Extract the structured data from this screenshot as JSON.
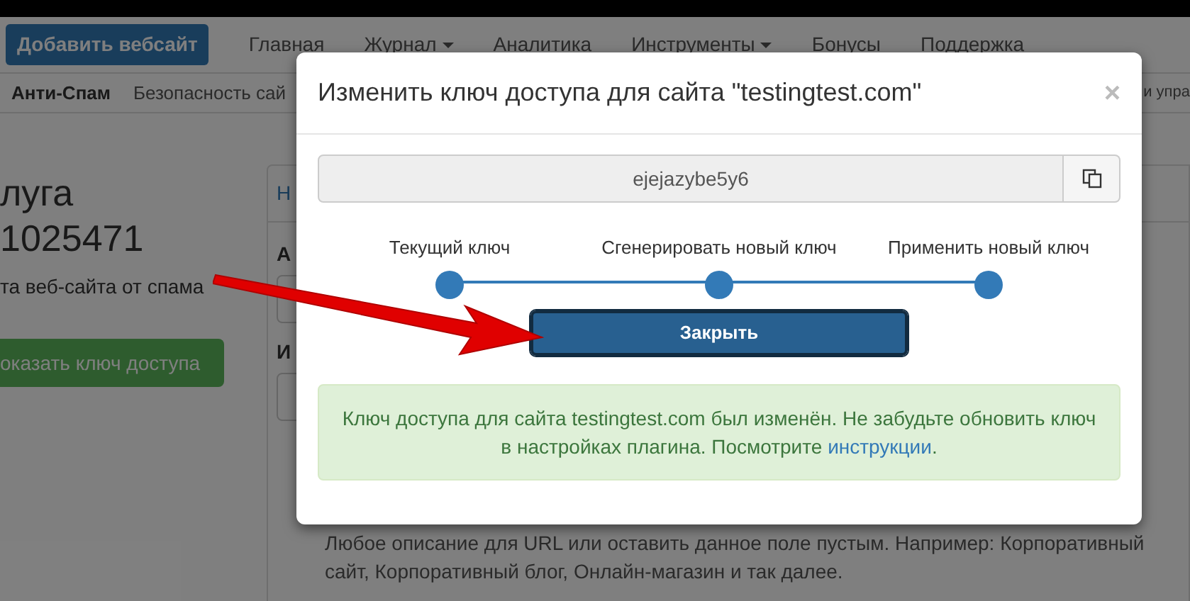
{
  "navbar": {
    "add_button": "Добавить вебсайт",
    "items": [
      {
        "label": "Главная",
        "dropdown": false
      },
      {
        "label": "Журнал",
        "dropdown": true
      },
      {
        "label": "Аналитика",
        "dropdown": false
      },
      {
        "label": "Инструменты",
        "dropdown": true
      },
      {
        "label": "Бонусы",
        "dropdown": false
      },
      {
        "label": "Поддержка",
        "dropdown": false
      }
    ]
  },
  "subnav": {
    "items": [
      {
        "label": "Анти-Спам",
        "selected": true
      },
      {
        "label": "Безопасность сай",
        "selected": false
      }
    ],
    "right_text": "и упра"
  },
  "service": {
    "title_line1": "луга",
    "title_line2": "1025471",
    "subtitle": "та веб-сайта от спама",
    "show_key_button": "оказать ключ доступа"
  },
  "panel": {
    "tab": "Н",
    "label_1": "А",
    "label_2": "И",
    "help_line1": "Любое описание для URL или оставить данное поле пустым. Например: Корпоративный",
    "help_line2": "сайт, Корпоративный блог, Онлайн-магазин и так далее."
  },
  "modal": {
    "title": "Изменить ключ доступа для сайта \"testingtest.com\"",
    "close": "×",
    "key_value": "ejejazybe5y6",
    "steps": [
      "Текущий ключ",
      "Сгенерировать новый ключ",
      "Применить новый ключ"
    ],
    "close_button": "Закрыть",
    "alert_text": "Ключ доступа для сайта testingtest.com был изменён. Не забудьте обновить ключ в настройках плагина. Посмотрите",
    "alert_link": "инструкции",
    "alert_end": "."
  }
}
